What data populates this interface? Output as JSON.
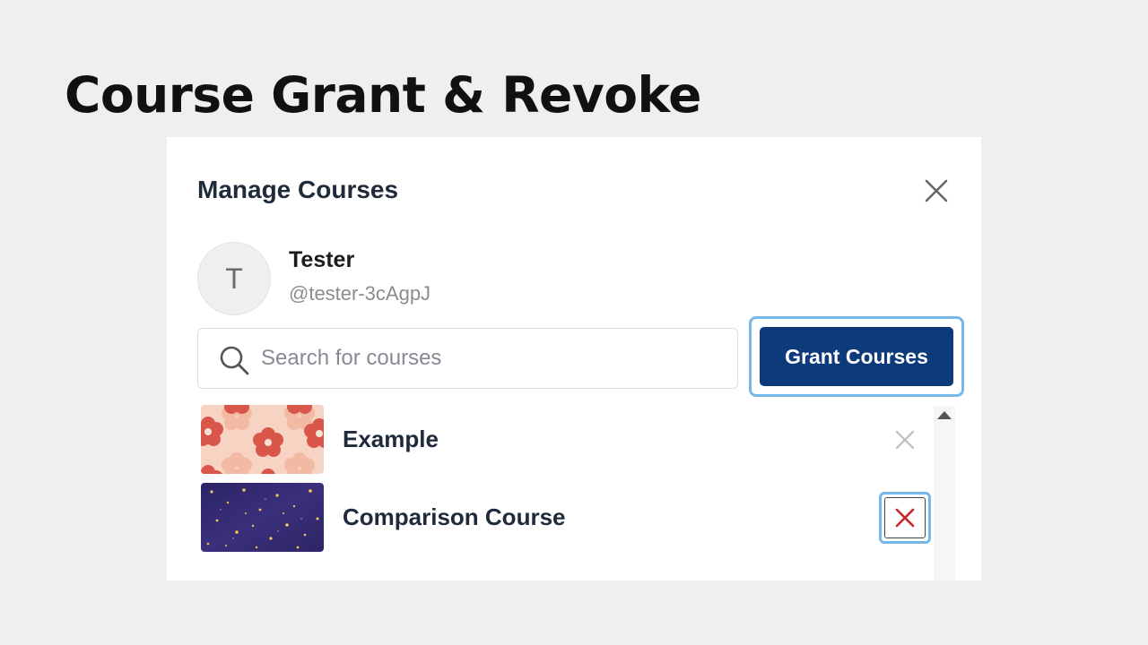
{
  "slide": {
    "title": "Course Grant & Revoke"
  },
  "modal": {
    "title": "Manage Courses",
    "close_icon": "close-icon"
  },
  "user": {
    "initial": "T",
    "name": "Tester",
    "handle": "@tester-3cAgpJ"
  },
  "search": {
    "placeholder": "Search for courses",
    "value": "",
    "icon": "search-icon"
  },
  "grant_button": {
    "label": "Grant Courses"
  },
  "courses": [
    {
      "title": "Example",
      "thumbnail": "pink-flower-pattern",
      "remove_icon": "close-icon",
      "focused": false
    },
    {
      "title": "Comparison Course",
      "thumbnail": "starry-night",
      "remove_icon": "close-icon",
      "focused": true
    }
  ],
  "colors": {
    "page_background": "#efefef",
    "primary_button": "#0d3a7a",
    "focus_ring": "#77b8ea",
    "remove_active": "#c62828",
    "remove_inactive": "#bdbdbd"
  }
}
